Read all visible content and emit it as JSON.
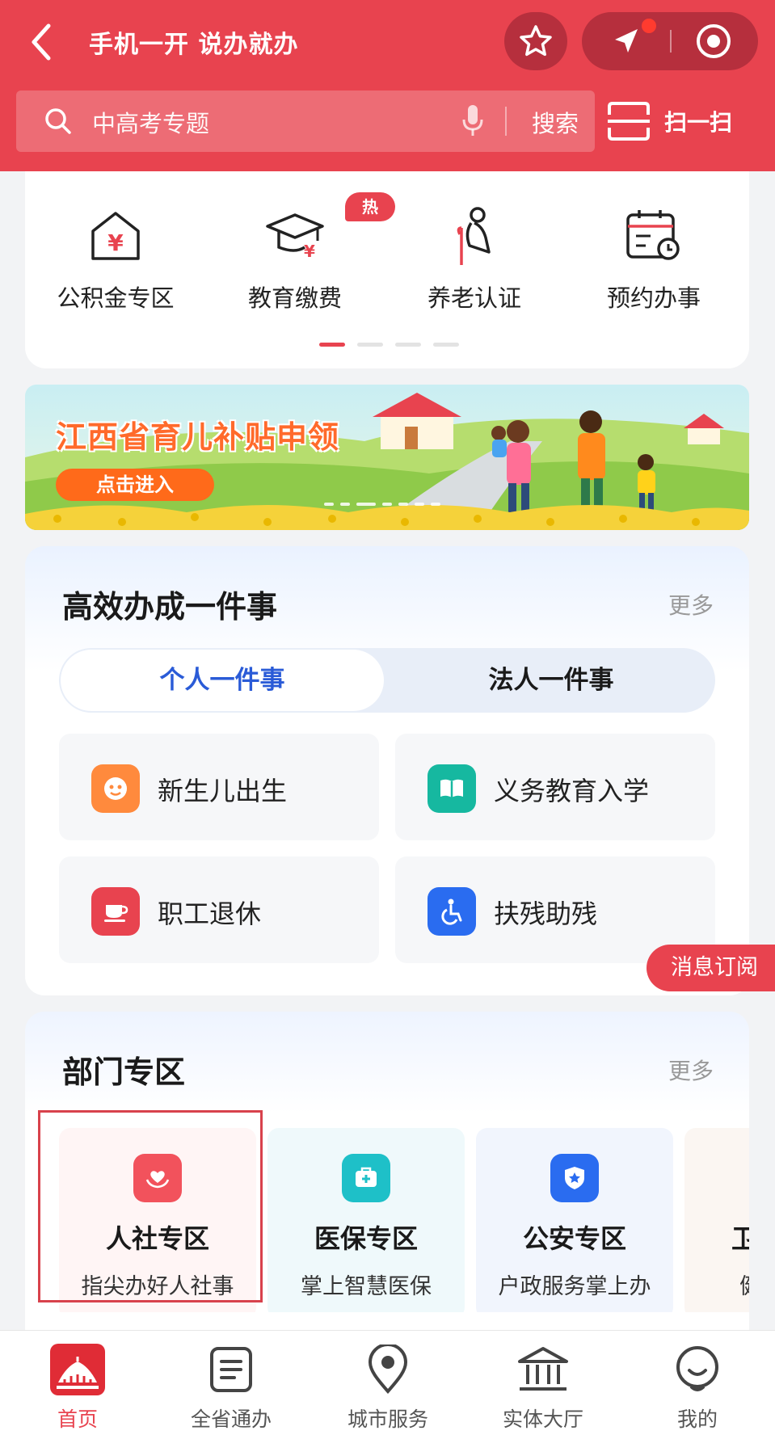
{
  "colors": {
    "primary": "#e8434f",
    "accent_blue": "#2a5bd7"
  },
  "header": {
    "title": "手机一开 说办就办",
    "back_icon": "chevron-left-icon",
    "favorite_icon": "star-icon",
    "location_icon": "location-arrow-icon",
    "target_icon": "target-icon"
  },
  "search": {
    "placeholder": "中高考专题",
    "button_label": "搜索",
    "scan_label": "扫一扫"
  },
  "quick_services": {
    "items": [
      {
        "label": "公积金专区",
        "icon": "housing-fund-icon"
      },
      {
        "label": "教育缴费",
        "icon": "graduation-cap-icon",
        "badge": "热"
      },
      {
        "label": "养老认证",
        "icon": "elderly-icon"
      },
      {
        "label": "预约办事",
        "icon": "calendar-clock-icon"
      }
    ],
    "page_index": 1,
    "page_count": 4
  },
  "banner": {
    "title": "江西省育儿补贴申领",
    "cta": "点击进入"
  },
  "efficient": {
    "title": "高效办成一件事",
    "more": "更多",
    "tabs": [
      {
        "label": "个人一件事",
        "active": true
      },
      {
        "label": "法人一件事",
        "active": false
      }
    ],
    "items": [
      {
        "label": "新生儿出生",
        "icon": "baby-face-icon",
        "color": "#ff8a3d"
      },
      {
        "label": "义务教育入学",
        "icon": "book-icon",
        "color": "#16b8a0"
      },
      {
        "label": "职工退休",
        "icon": "tea-cup-icon",
        "color": "#e8434f"
      },
      {
        "label": "扶残助残",
        "icon": "wheelchair-icon",
        "color": "#2a6cf0"
      }
    ]
  },
  "subscribe": {
    "label": "消息订阅"
  },
  "departments": {
    "title": "部门专区",
    "more": "更多",
    "items": [
      {
        "title": "人社专区",
        "subtitle": "指尖办好人社事",
        "icon": "heart-hands-icon",
        "color": "#f2525c"
      },
      {
        "title": "医保专区",
        "subtitle": "掌上智慧医保",
        "icon": "medical-kit-icon",
        "color": "#1ec0c8"
      },
      {
        "title": "公安专区",
        "subtitle": "户政服务掌上办",
        "icon": "police-badge-icon",
        "color": "#2a6cf0"
      },
      {
        "title": "卫健专区",
        "subtitle": "健康服务",
        "icon": "health-icon",
        "color": "#ff8a3d"
      }
    ]
  },
  "bottom_nav": [
    {
      "label": "首页",
      "icon": "home-icon",
      "active": true
    },
    {
      "label": "全省通办",
      "icon": "document-list-icon",
      "active": false
    },
    {
      "label": "城市服务",
      "icon": "map-pin-icon",
      "active": false
    },
    {
      "label": "实体大厅",
      "icon": "building-icon",
      "active": false
    },
    {
      "label": "我的",
      "icon": "user-icon",
      "active": false
    }
  ]
}
